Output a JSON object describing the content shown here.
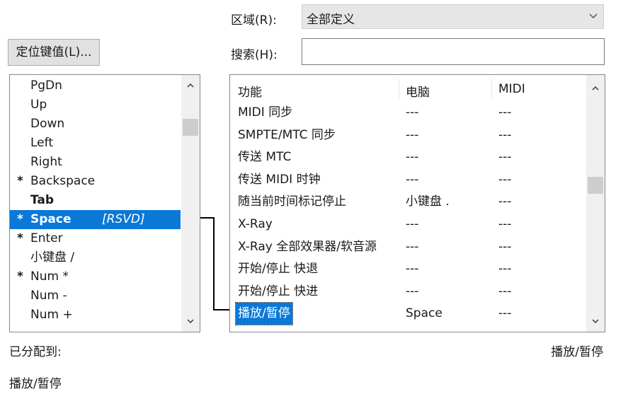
{
  "region": {
    "label": "区域(R):",
    "value": "全部定义",
    "chevron_icon": "chevron-down-icon"
  },
  "search": {
    "label": "搜索(H):",
    "value": ""
  },
  "locate_button": {
    "label": "定位键值(L)..."
  },
  "key_list": {
    "items": [
      {
        "star": "",
        "name": "PgDn",
        "tag": "",
        "bold": false,
        "selected": false
      },
      {
        "star": "",
        "name": "Up",
        "tag": "",
        "bold": false,
        "selected": false
      },
      {
        "star": "",
        "name": "Down",
        "tag": "",
        "bold": false,
        "selected": false
      },
      {
        "star": "",
        "name": "Left",
        "tag": "",
        "bold": false,
        "selected": false
      },
      {
        "star": "",
        "name": "Right",
        "tag": "",
        "bold": false,
        "selected": false
      },
      {
        "star": "*",
        "name": "Backspace",
        "tag": "",
        "bold": false,
        "selected": false
      },
      {
        "star": "",
        "name": "Tab",
        "tag": "",
        "bold": true,
        "selected": false
      },
      {
        "star": "*",
        "name": "Space",
        "tag": "[RSVD]",
        "bold": true,
        "selected": true
      },
      {
        "star": "*",
        "name": "Enter",
        "tag": "",
        "bold": false,
        "selected": false
      },
      {
        "star": "",
        "name": "小键盘 /",
        "tag": "",
        "bold": false,
        "selected": false
      },
      {
        "star": "*",
        "name": "Num *",
        "tag": "",
        "bold": false,
        "selected": false
      },
      {
        "star": "",
        "name": "Num -",
        "tag": "",
        "bold": false,
        "selected": false
      },
      {
        "star": "",
        "name": "Num +",
        "tag": "",
        "bold": false,
        "selected": false
      }
    ]
  },
  "function_table": {
    "headers": [
      "功能",
      "电脑",
      "MIDI"
    ],
    "rows": [
      {
        "func": "MIDI 同步",
        "pc": "---",
        "midi": "---",
        "selected": false
      },
      {
        "func": "SMPTE/MTC 同步",
        "pc": "---",
        "midi": "---",
        "selected": false
      },
      {
        "func": "传送 MTC",
        "pc": "---",
        "midi": "---",
        "selected": false
      },
      {
        "func": "传送 MIDI 时钟",
        "pc": "---",
        "midi": "---",
        "selected": false
      },
      {
        "func": "随当前时间标记停止",
        "pc": "小键盘 .",
        "midi": "---",
        "selected": false
      },
      {
        "func": "X-Ray",
        "pc": "---",
        "midi": "---",
        "selected": false
      },
      {
        "func": "X-Ray 全部效果器/软音源",
        "pc": "---",
        "midi": "---",
        "selected": false
      },
      {
        "func": "开始/停止 快退",
        "pc": "---",
        "midi": "---",
        "selected": false
      },
      {
        "func": "开始/停止 快进",
        "pc": "---",
        "midi": "---",
        "selected": false
      },
      {
        "func": "播放/暂停",
        "pc": "Space",
        "midi": "---",
        "selected": true
      }
    ]
  },
  "assigned": {
    "label": "已分配到:",
    "value": "播放/暂停",
    "right_value": "播放/暂停"
  },
  "colors": {
    "selection": "#0a78d7"
  }
}
